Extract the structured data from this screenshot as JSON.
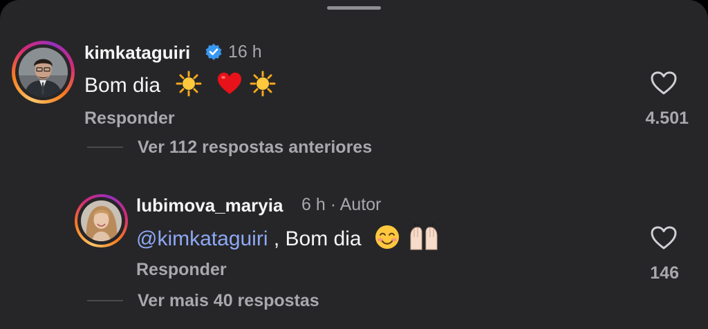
{
  "comments": [
    {
      "username": "kimkataguiri",
      "verified": true,
      "time": "16 h",
      "text": "Bom dia",
      "reply_label": "Responder",
      "likes": "4.501",
      "view_replies": "Ver 112 respostas anteriores"
    },
    {
      "username": "lubimova_maryia",
      "time": "6 h",
      "separator": "·",
      "author_tag": "Autor",
      "mention": "@kimkataguiri",
      "text": ", Bom dia",
      "reply_label": "Responder",
      "likes": "146",
      "view_replies": "Ver mais 40 respostas"
    }
  ],
  "colors": {
    "background": "#262628",
    "mention": "#8ea8f5",
    "verified": "#3897f0",
    "heart": "#e8121a"
  },
  "icons": [
    "sun-icon",
    "red-heart-icon",
    "smiling-face-icon",
    "raising-hands-icon",
    "heart-outline-icon",
    "verified-badge-icon"
  ]
}
